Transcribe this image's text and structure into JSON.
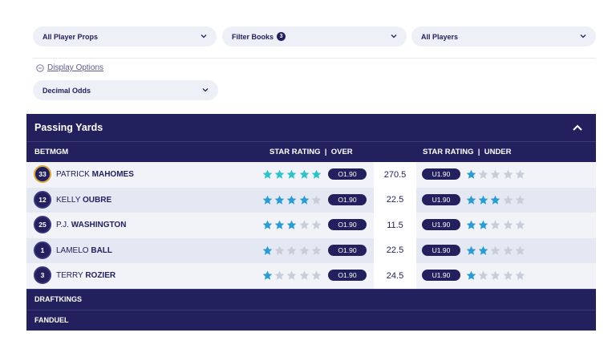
{
  "filters": {
    "props": "All Player Props",
    "books": "Filter Books",
    "books_count": "3",
    "players": "All Players"
  },
  "display_options": "Display Options",
  "odds_format": "Decimal Odds",
  "market": {
    "title": "Passing Yards",
    "book": "BETMGM",
    "over_header": "STAR RATING  |  OVER",
    "under_header": "STAR RATING  |  UNDER",
    "rows": [
      {
        "number": "33",
        "first": "PATRICK",
        "last": "MAHOMES",
        "over_stars": 5,
        "over_odds": "O1.90",
        "line": "270.5",
        "under_odds": "U1.90",
        "under_stars": 1
      },
      {
        "number": "12",
        "first": "KELLY",
        "last": "OUBRE",
        "over_stars": 4,
        "over_odds": "O1.90",
        "line": "22.5",
        "under_odds": "U1.90",
        "under_stars": 3
      },
      {
        "number": "25",
        "first": "P.J.",
        "last": "WASHINGTON",
        "over_stars": 3,
        "over_odds": "O1.90",
        "line": "11.5",
        "under_odds": "U1.90",
        "under_stars": 2
      },
      {
        "number": "1",
        "first": "LAMELO",
        "last": "BALL",
        "over_stars": 1,
        "over_odds": "O1.90",
        "line": "22.5",
        "under_odds": "U1.90",
        "under_stars": 2
      },
      {
        "number": "3",
        "first": "TERRY",
        "last": "ROZIER",
        "over_stars": 1,
        "over_odds": "O1.90",
        "line": "24.5",
        "under_odds": "U1.90",
        "under_stars": 1
      }
    ],
    "other_books": [
      "DRAFTKINGS",
      "FANDUEL"
    ]
  },
  "colors": {
    "navy": "#23215d",
    "star_teal": "#2fc2c9",
    "star_blue": "#2b9bd1",
    "star_empty": "#c9ccd9"
  }
}
